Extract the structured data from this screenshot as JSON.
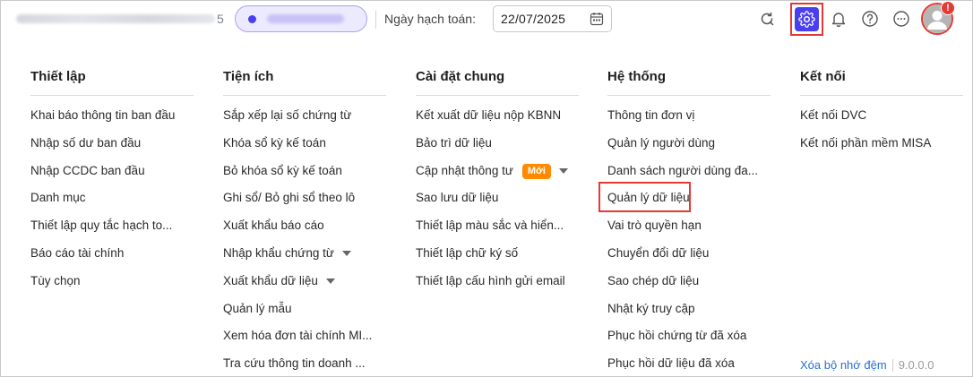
{
  "header": {
    "company_suffix": "5",
    "date_label": "Ngày hạch toán:",
    "date_value": "22/07/2025",
    "notification_badge": "!"
  },
  "menu": {
    "columns": [
      {
        "title": "Thiết lập",
        "items": [
          {
            "label": "Khai báo thông tin ban đầu"
          },
          {
            "label": "Nhập số dư ban đầu"
          },
          {
            "label": "Nhập CCDC ban đầu"
          },
          {
            "label": "Danh mục"
          },
          {
            "label": "Thiết lập quy tắc hạch to..."
          },
          {
            "label": "Báo cáo tài chính"
          },
          {
            "label": "Tùy chọn"
          }
        ]
      },
      {
        "title": "Tiện ích",
        "items": [
          {
            "label": "Sắp xếp lại số chứng từ"
          },
          {
            "label": "Khóa sổ kỳ kế toán"
          },
          {
            "label": "Bỏ khóa sổ kỳ kế toán"
          },
          {
            "label": "Ghi sổ/ Bỏ ghi sổ theo lô"
          },
          {
            "label": "Xuất khẩu báo cáo"
          },
          {
            "label": "Nhập khẩu chứng từ",
            "caret": true
          },
          {
            "label": "Xuất khẩu dữ liệu",
            "caret": true
          },
          {
            "label": "Quản lý mẫu"
          },
          {
            "label": "Xem hóa đơn tài chính MI..."
          },
          {
            "label": "Tra cứu thông tin doanh ..."
          }
        ]
      },
      {
        "title": "Cài đặt chung",
        "items": [
          {
            "label": "Kết xuất dữ liệu nộp KBNN"
          },
          {
            "label": "Bảo trì dữ liệu"
          },
          {
            "label": "Cập nhật thông tư",
            "badge": "Mới",
            "caret": true
          },
          {
            "label": "Sao lưu dữ liệu"
          },
          {
            "label": "Thiết lập màu sắc và hiển..."
          },
          {
            "label": "Thiết lập chữ ký số"
          },
          {
            "label": "Thiết lập cấu hình gửi email"
          }
        ]
      },
      {
        "title": "Hệ thống",
        "items": [
          {
            "label": "Thông tin đơn vị"
          },
          {
            "label": "Quản lý người dùng"
          },
          {
            "label": "Danh sách người dùng đa..."
          },
          {
            "label": "Quản lý dữ liệu"
          },
          {
            "label": "Vai trò quyền hạn"
          },
          {
            "label": "Chuyển đổi dữ liệu"
          },
          {
            "label": "Sao chép dữ liệu"
          },
          {
            "label": "Nhật ký truy cập"
          },
          {
            "label": "Phục hồi chứng từ đã xóa"
          },
          {
            "label": "Phục hồi dữ liệu đã xóa"
          }
        ]
      },
      {
        "title": "Kết nối",
        "items": [
          {
            "label": "Kết nối DVC"
          },
          {
            "label": "Kết nối phần mềm MISA"
          }
        ]
      }
    ]
  },
  "footer": {
    "clear_cache": "Xóa bộ nhớ đệm",
    "version": "9.0.0.0"
  },
  "colors": {
    "accent": "#4a3ff0",
    "highlight": "#e53935",
    "new_badge": "#ff8a00",
    "link": "#2b6fd6"
  }
}
